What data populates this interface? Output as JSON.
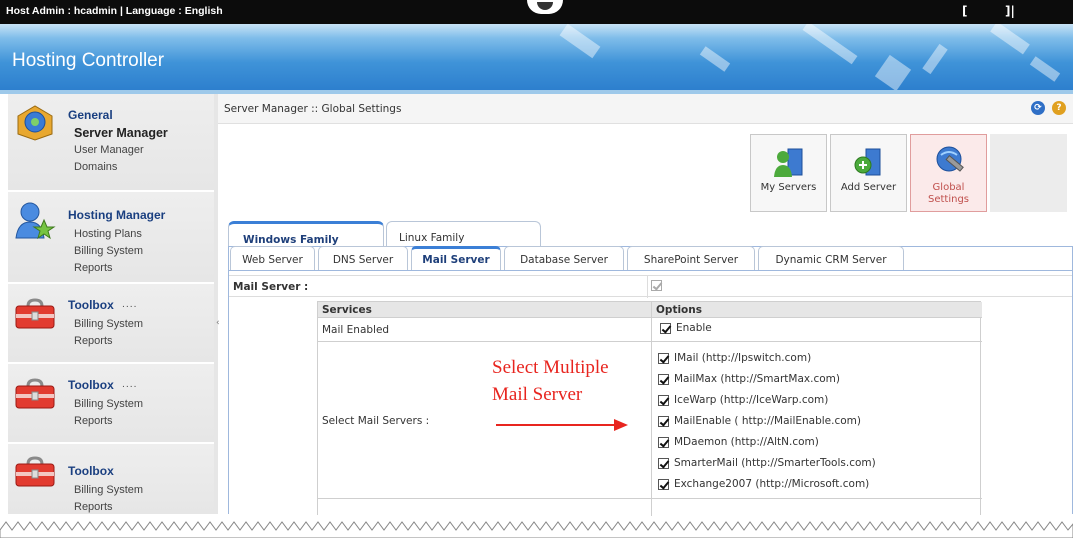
{
  "topbar": {
    "info": "Host Admin : hcadmin | Language : English",
    "bracket_left": "[",
    "bracket_right": "]|"
  },
  "banner": {
    "title": "Hosting Controller"
  },
  "sidebar": {
    "general": {
      "heading": "General",
      "items": [
        "Server Manager",
        "User Manager",
        "Domains"
      ]
    },
    "hosting": {
      "heading": "Hosting Manager",
      "items": [
        "Hosting Plans",
        "Billing System",
        "Reports"
      ]
    },
    "toolbox1": {
      "heading": "Toolbox",
      "items": [
        "Billing System",
        "Reports"
      ]
    },
    "toolbox2": {
      "heading": "Toolbox",
      "items": [
        "Billing System",
        "Reports"
      ]
    },
    "toolbox3": {
      "heading": "Toolbox",
      "items": [
        "Billing System",
        "Reports"
      ]
    }
  },
  "breadcrumb": "Server Manager :: Global Settings",
  "toolbar": {
    "my_servers": "My Servers",
    "add_server": "Add Server",
    "global_settings": "Global Settings"
  },
  "family_tabs": [
    "Windows Family",
    "Linux Family"
  ],
  "sub_tabs": [
    "Web Server",
    "DNS Server",
    "Mail Server",
    "Database Server",
    "SharePoint Server",
    "Dynamic CRM Server"
  ],
  "mail_server_label": "Mail Server :",
  "grid": {
    "headers": {
      "services": "Services",
      "options": "Options"
    },
    "mail_enabled": {
      "label": "Mail Enabled",
      "option": "Enable"
    },
    "select_label": "Select Mail Servers :",
    "servers": [
      "IMail (http://Ipswitch.com)",
      "MailMax (http://SmartMax.com)",
      "IceWarp (http://IceWarp.com)",
      "MailEnable ( http://MailEnable.com)",
      "MDaemon (http://AltN.com)",
      "SmarterMail (http://SmarterTools.com)",
      "Exchange2007 (http://Microsoft.com)"
    ]
  },
  "annotation": {
    "line1": "Select Multiple",
    "line2": "Mail Server"
  },
  "colors": {
    "accent": "#3b7fd6",
    "annotation": "#e8251f",
    "heading": "#1a3f80"
  }
}
